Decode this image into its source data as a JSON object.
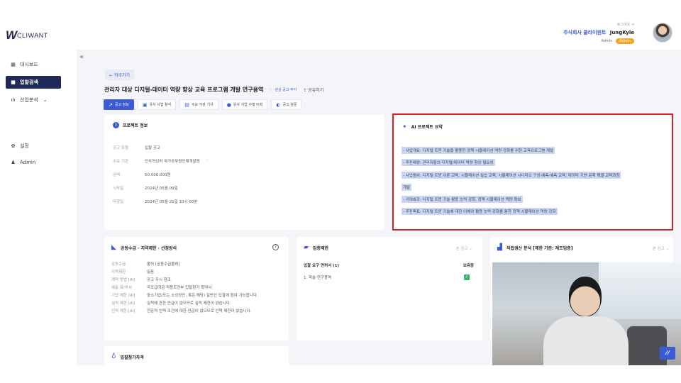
{
  "header": {
    "logo_mark": "W",
    "logo_text": "CLIWANT",
    "logout": "로그아웃",
    "company": "주식회사 클라이원트",
    "username": "JungKyle",
    "role": "Admin",
    "badge": "Admin"
  },
  "sidebar": {
    "collapse": "«",
    "items": [
      {
        "icon": "▦",
        "label": "대시보드"
      },
      {
        "icon": "■",
        "label": "입찰검색"
      },
      {
        "icon": "ılı",
        "label": "산업분석",
        "chevron": "⌄"
      },
      {
        "icon": "✿",
        "label": "설정"
      },
      {
        "icon": "♟",
        "label": "Admin"
      }
    ]
  },
  "page": {
    "back": "뒤로가기",
    "title": "관리자 대상 디지털-데이터 역량 향상 교육 프로그램 개발 연구용역",
    "favorite_star": "☆",
    "favorite_label": "관심 공고 추가",
    "share_label": "공유하기",
    "tabs": [
      {
        "icon": "↗",
        "label": "공고 정보"
      },
      {
        "icon": "▣",
        "label": "유사 사업 분석"
      },
      {
        "icon": "▤",
        "label": "수요 기관 기사"
      },
      {
        "icon": "●",
        "label": "유사 사업 수행 이력"
      },
      {
        "icon": "◐",
        "label": "공고 원문"
      }
    ]
  },
  "project": {
    "heading": "프로젝트 정보",
    "rows": [
      {
        "label": "공고 유형",
        "value": "입찰 공고"
      },
      {
        "label": "수요 기관",
        "value": "인사혁신처 국가공무원인재개발원",
        "star": "☆"
      },
      {
        "label": "금액",
        "value": "50,000,000원"
      },
      {
        "label": "시작일",
        "value": "2024년 05월 09일"
      },
      {
        "label": "마감일",
        "value": "2024년 05월 21일 10시 00분"
      }
    ]
  },
  "ai": {
    "heading": "AI 프로젝트 요약",
    "lines": [
      "- 사업개요: 디지털 트윈 기술을 활용한 정책 시뮬레이션 역량 강화를 위한 교육프로그램 개발",
      "- 추진배경: 관리자들의 디지털/데이터 역량 향상 필요성",
      "- 사업범위: 디지털 트윈 이론 교육, 시뮬레이션 실습 교육, 시뮬레이션 시나리오 구성·예측·예측 교육, 데이터 기반 문제 해결 교육과정",
      "개발",
      "- 기대효과: 디지털 트윈 기술 활용 능력 강화, 정책 시뮬레이션 역량 확보",
      "- 추진목표: 디지털 트윈 기술에 대한 이해와 활용 능력 강화를 통한 정책 시뮬레이션 역량 강화"
    ]
  },
  "contract": {
    "heading": "공동수급 · 지역제한 · 선정방식",
    "help": "?",
    "rows": [
      {
        "label": "공동수급",
        "value": "불허 [공동수급불허]"
      },
      {
        "label": "지역제한",
        "value": "없음"
      },
      {
        "label": "계약 방법 [AI]",
        "value": "공고 우시 참조"
      },
      {
        "label": "제출 폭/악서",
        "value": "국조급대금 적용조건부 입찰참가 확약서"
      },
      {
        "label": "기업 제한 [AI]",
        "value": "중소기업(또는 소상공인, 혹은 해당) 일반인 입찰에 참여 가능합니다."
      },
      {
        "label": "실적 제한 [AI]",
        "value": "실적에 관한 언급이 없으므로 실적 제한이 없습니다."
      },
      {
        "label": "인적 제한 [AI]",
        "value": "전문적 인력 조건에 대한 언급이 없으므로 인력 제한이 없습니다."
      }
    ]
  },
  "industry": {
    "heading": "업종제한",
    "dropdown": "본 공고 ⌄",
    "col_left": "입찰 요구 면허서 (1)",
    "col_right": "보유중",
    "row_label": "1. 학술·연구용역",
    "check": "✓"
  },
  "production": {
    "heading": "직접생산 분석 [제한 기준: 제조업종]",
    "dropdown": "본 공고 ⌄"
  },
  "bidders": {
    "heading": "입찰참가자격"
  },
  "video": {
    "logo": "//"
  },
  "colors": {
    "brand": "#3b5bd6",
    "sidebar_active": "#1f2a5a",
    "highlight_border": "#d92028",
    "badge": "#f5a623"
  }
}
